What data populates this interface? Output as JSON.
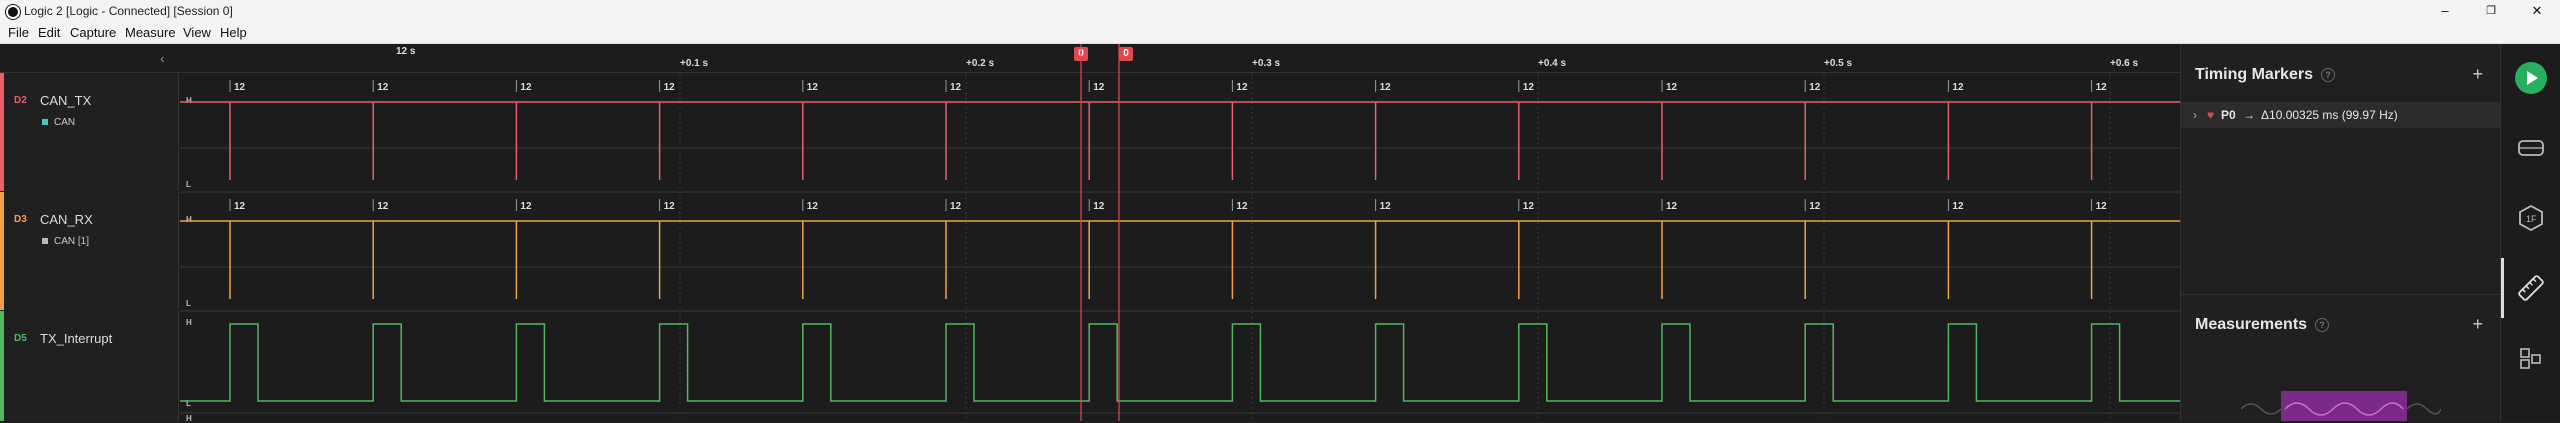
{
  "window": {
    "title": "Logic 2 [Logic - Connected] [Session 0]",
    "minimize": "–",
    "maximize": "❐",
    "close": "✕"
  },
  "menu": [
    "File",
    "Edit",
    "Capture",
    "Measure",
    "View",
    "Help"
  ],
  "ruler": {
    "start_label": "12 s",
    "ticks": [
      "+0.1 s",
      "+0.2 s",
      "+0.3 s",
      "+0.4 s",
      "+0.5 s",
      "+0.6 s"
    ],
    "markers": [
      "0",
      "0"
    ]
  },
  "channels": [
    {
      "id": "D2",
      "name": "CAN_TX",
      "color": "#e8606a",
      "analyzer": "CAN",
      "analyzer_color": "#47c8c8"
    },
    {
      "id": "D3",
      "name": "CAN_RX",
      "color": "#f0a24a",
      "analyzer": "CAN [1]",
      "analyzer_color": "#bbbbbb"
    },
    {
      "id": "D5",
      "name": "TX_Interrupt",
      "color": "#52b85f"
    }
  ],
  "level_labels": {
    "high": "H",
    "low": "L"
  },
  "frame_label": "12",
  "timing_markers": {
    "title": "Timing Markers",
    "help": "?",
    "add": "+",
    "row": {
      "expand": "›",
      "name": "P0",
      "arrow": "→",
      "value": "Δ10.00325 ms (99.97 Hz)"
    }
  },
  "measurements": {
    "title": "Measurements",
    "help": "?",
    "add": "+"
  },
  "colors": {
    "accent_green": "#27ae60",
    "marker_red": "#e0494f",
    "measure_purple": "#7a2a87"
  },
  "sidebar_icons": [
    "play-icon",
    "analyzers-icon",
    "extensions-icon",
    "timing-icon",
    "layout-icon"
  ]
}
